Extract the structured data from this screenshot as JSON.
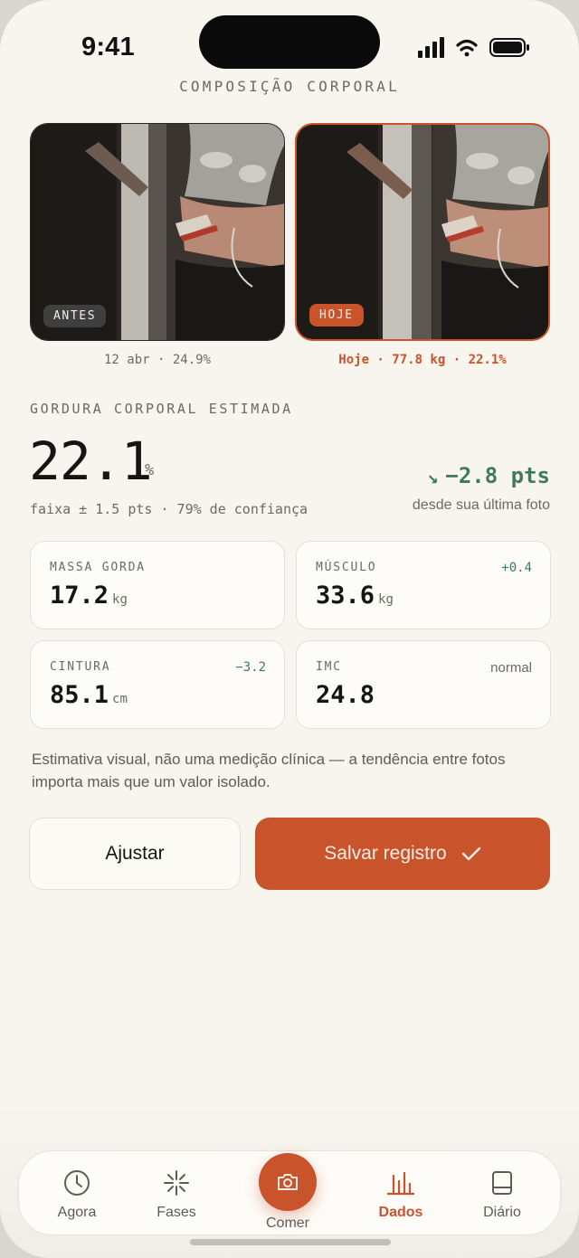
{
  "status": {
    "time": "9:41"
  },
  "header": {
    "title": "COMPOSIÇÃO CORPORAL"
  },
  "photos": {
    "before": {
      "tag": "ANTES",
      "caption": "12 abr · 24.9%"
    },
    "today": {
      "tag": "HOJE",
      "caption": "Hoje · 77.8 kg · 22.1%"
    }
  },
  "estimate": {
    "label": "GORDURA CORPORAL ESTIMADA",
    "value": "22.1",
    "unit": "%",
    "range": "faixa ± 1.5 pts · 79% de confiança",
    "delta": "−2.8 pts",
    "delta_arrow": "↘",
    "delta_sub": "desde sua última foto"
  },
  "metrics": [
    {
      "label": "MASSA GORDA",
      "value": "17.2",
      "unit": "kg",
      "badge": ""
    },
    {
      "label": "MÚSCULO",
      "value": "33.6",
      "unit": "kg",
      "badge": "+0.4"
    },
    {
      "label": "CINTURA",
      "value": "85.1",
      "unit": "cm",
      "badge": "−3.2"
    },
    {
      "label": "IMC",
      "value": "24.8",
      "unit": "",
      "badge": "normal"
    }
  ],
  "note": "Estimativa visual, não uma medição clínica — a tendência entre fotos importa mais que um valor isolado.",
  "actions": {
    "adjust": "Ajustar",
    "save": "Salvar registro",
    "save_icon": "check-icon"
  },
  "tabs": [
    {
      "label": "Agora",
      "icon": "clock-icon"
    },
    {
      "label": "Fases",
      "icon": "sparkle-icon"
    },
    {
      "label": "Comer",
      "icon": "camera-icon"
    },
    {
      "label": "Dados",
      "icon": "bar-chart-icon",
      "active": true
    },
    {
      "label": "Diário",
      "icon": "journal-icon"
    }
  ],
  "colors": {
    "accent": "#c9532a",
    "positive": "#3f7a5f",
    "background": "#f7f5ee",
    "text": "#161513"
  }
}
